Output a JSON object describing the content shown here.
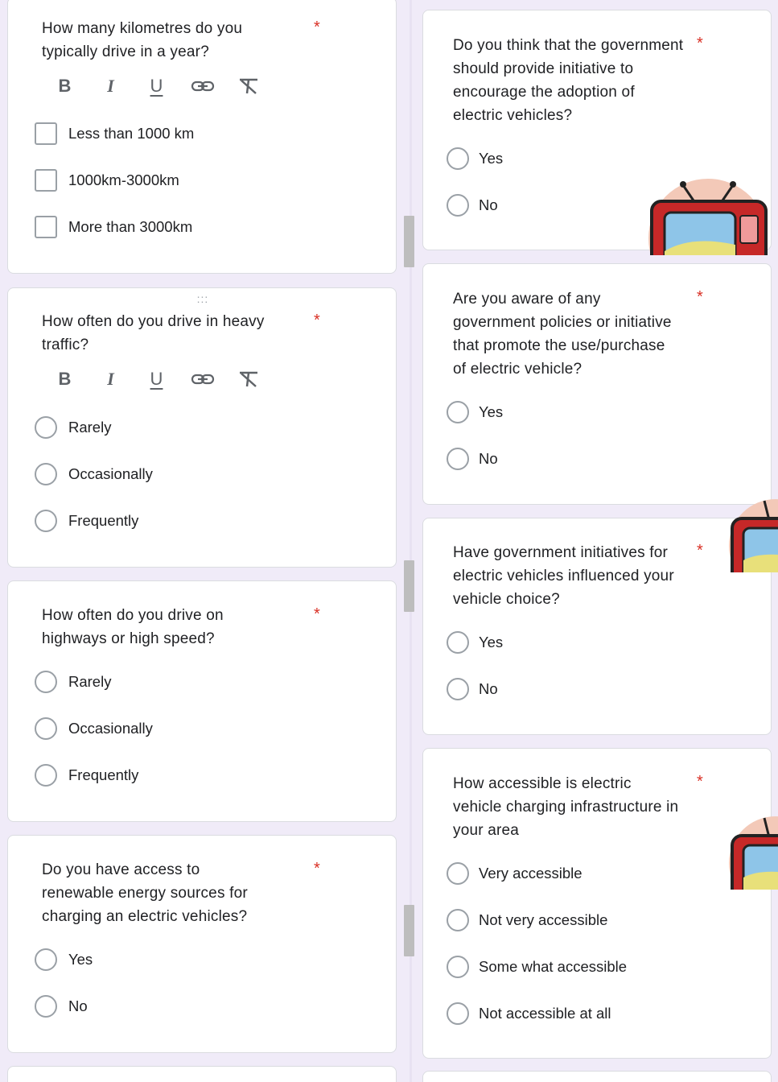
{
  "required_marker": "*",
  "toolbar": {
    "bold": "B",
    "italic": "I",
    "underline": "U"
  },
  "drag_handle": ":::",
  "left_questions": [
    {
      "title_lines": [
        "How many kilometres do you",
        "typically drive in a year?"
      ],
      "type": "checkbox",
      "options": [
        "Less than 1000 km",
        "1000km-3000km",
        "More than 3000km"
      ]
    },
    {
      "title_lines": [
        "How often do you drive in heavy",
        "traffic?"
      ],
      "type": "radio",
      "options": [
        "Rarely",
        "Occasionally",
        "Frequently"
      ]
    },
    {
      "title_lines": [
        "How often do you drive on",
        "highways or high speed?"
      ],
      "type": "radio",
      "options": [
        "Rarely",
        "Occasionally",
        "Frequently"
      ]
    },
    {
      "title_lines": [
        "Do you have access to",
        "renewable energy sources for",
        "charging an electric vehicles?"
      ],
      "type": "radio",
      "options": [
        "Yes",
        "No"
      ]
    }
  ],
  "right_questions": [
    {
      "title_lines": [
        "Do you think that the government",
        "should provide initiative to",
        "encourage the adoption of",
        "electric vehicles?"
      ],
      "type": "radio",
      "options": [
        "Yes",
        "No"
      ]
    },
    {
      "title_lines": [
        "Are you aware of any",
        "government policies or initiative",
        "that promote the use/purchase",
        "of electric vehicle?"
      ],
      "type": "radio",
      "options": [
        "Yes",
        "No"
      ]
    },
    {
      "title_lines": [
        "Have government initiatives for",
        "electric vehicles influenced your",
        "vehicle choice?"
      ],
      "type": "radio",
      "options": [
        "Yes",
        "No"
      ]
    },
    {
      "title_lines": [
        "How accessible is electric",
        "vehicle charging infrastructure in",
        "your area"
      ],
      "type": "radio",
      "options": [
        "Very accessible",
        "Not very accessible",
        "Some what accessible",
        "Not accessible at all"
      ]
    }
  ],
  "colors": {
    "background": "#f0ebf8",
    "card": "#ffffff",
    "required": "#d93025",
    "accent": "#673ab7",
    "control_border": "#9aa0a6"
  },
  "icons": [
    "bold-icon",
    "italic-icon",
    "underline-icon",
    "link-icon",
    "clear-format-icon",
    "drag-handle-icon",
    "tv-sticker-icon"
  ]
}
